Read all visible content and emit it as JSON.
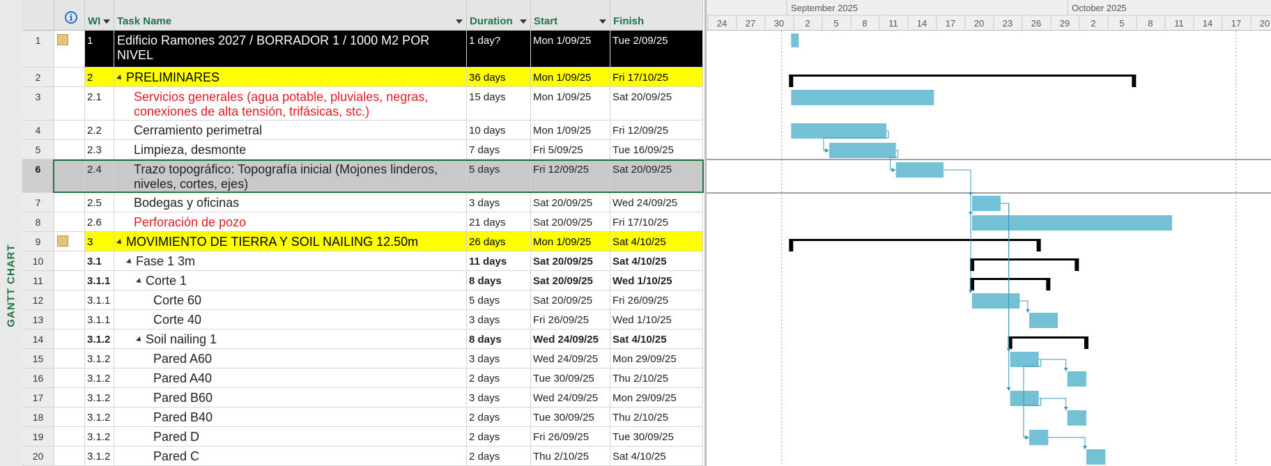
{
  "side_label": "GANTT CHART",
  "columns": {
    "wbs": "WI",
    "name": "Task Name",
    "duration": "Duration",
    "start": "Start",
    "finish": "Finish"
  },
  "colors": {
    "accent": "#217346",
    "bar": "#74c0d4",
    "summary_yellow": "#ffff00",
    "title_black": "#000000",
    "red_text": "#e31b23",
    "link": "#3a9ab4"
  },
  "rows": [
    {
      "id": "1",
      "wbs": "1",
      "name": "Edificio Ramones 2027 / BORRADOR 1 / 1000 M2 POR NIVEL",
      "duration": "1 day?",
      "start": "Mon 1/09/25",
      "finish": "Tue 2/09/25",
      "style": "title",
      "note": true,
      "indent": 0
    },
    {
      "id": "2",
      "wbs": "2",
      "name": "PRELIMINARES",
      "duration": "36 days",
      "start": "Mon 1/09/25",
      "finish": "Fri 17/10/25",
      "style": "yellow",
      "collapse": true,
      "indent": 0
    },
    {
      "id": "3",
      "wbs": "2.1",
      "name": "Servicios generales (agua potable, pluviales, negras, conexiones de alta tensión, trifásicas, stc.)",
      "duration": "15 days",
      "start": "Mon 1/09/25",
      "finish": "Sat 20/09/25",
      "style": "red",
      "indent": 1
    },
    {
      "id": "4",
      "wbs": "2.2",
      "name": "Cerramiento perimetral",
      "duration": "10 days",
      "start": "Mon 1/09/25",
      "finish": "Fri 12/09/25",
      "indent": 1
    },
    {
      "id": "5",
      "wbs": "2.3",
      "name": "Limpieza, desmonte",
      "duration": "7 days",
      "start": "Fri 5/09/25",
      "finish": "Tue 16/09/25",
      "indent": 1
    },
    {
      "id": "6",
      "wbs": "2.4",
      "name": "Trazo topográfico: Topografía inicial (Mojones linderos, niveles, cortes, ejes)",
      "duration": "5 days",
      "start": "Fri 12/09/25",
      "finish": "Sat 20/09/25",
      "style": "sel",
      "indent": 1
    },
    {
      "id": "7",
      "wbs": "2.5",
      "name": "Bodegas y oficinas",
      "duration": "3 days",
      "start": "Sat 20/09/25",
      "finish": "Wed 24/09/25",
      "indent": 1
    },
    {
      "id": "8",
      "wbs": "2.6",
      "name": "Perforación de pozo",
      "duration": "21 days",
      "start": "Sat 20/09/25",
      "finish": "Fri 17/10/25",
      "style": "red",
      "indent": 1
    },
    {
      "id": "9",
      "wbs": "3",
      "name": "MOVIMIENTO DE TIERRA Y SOIL NAILING 12.50m",
      "duration": "26 days",
      "start": "Mon 1/09/25",
      "finish": "Sat 4/10/25",
      "style": "yellow",
      "collapse": true,
      "note": true,
      "indent": 0
    },
    {
      "id": "10",
      "wbs": "3.1",
      "name": "Fase 1 3m",
      "duration": "11 days",
      "start": "Sat 20/09/25",
      "finish": "Sat 4/10/25",
      "style": "summary",
      "collapse": true,
      "indent": 1
    },
    {
      "id": "11",
      "wbs": "3.1.1",
      "name": "Corte 1",
      "duration": "8 days",
      "start": "Sat 20/09/25",
      "finish": "Wed 1/10/25",
      "style": "summary",
      "collapse": true,
      "indent": 2
    },
    {
      "id": "12",
      "wbs": "3.1.1",
      "name": "Corte 60",
      "duration": "5 days",
      "start": "Sat 20/09/25",
      "finish": "Fri 26/09/25",
      "indent": 3
    },
    {
      "id": "13",
      "wbs": "3.1.1",
      "name": "Corte 40",
      "duration": "3 days",
      "start": "Fri 26/09/25",
      "finish": "Wed 1/10/25",
      "indent": 3
    },
    {
      "id": "14",
      "wbs": "3.1.2",
      "name": "Soil nailing 1",
      "duration": "8 days",
      "start": "Wed 24/09/25",
      "finish": "Sat 4/10/25",
      "style": "summary",
      "collapse": true,
      "indent": 2
    },
    {
      "id": "15",
      "wbs": "3.1.2",
      "name": "Pared A60",
      "duration": "3 days",
      "start": "Wed 24/09/25",
      "finish": "Mon 29/09/25",
      "indent": 3
    },
    {
      "id": "16",
      "wbs": "3.1.2",
      "name": "Pared A40",
      "duration": "2 days",
      "start": "Tue 30/09/25",
      "finish": "Thu 2/10/25",
      "indent": 3
    },
    {
      "id": "17",
      "wbs": "3.1.2",
      "name": "Pared B60",
      "duration": "3 days",
      "start": "Wed 24/09/25",
      "finish": "Mon 29/09/25",
      "indent": 3
    },
    {
      "id": "18",
      "wbs": "3.1.2",
      "name": "Pared B40",
      "duration": "2 days",
      "start": "Tue 30/09/25",
      "finish": "Thu 2/10/25",
      "indent": 3
    },
    {
      "id": "19",
      "wbs": "3.1.2",
      "name": "Pared D",
      "duration": "2 days",
      "start": "Fri 26/09/25",
      "finish": "Tue 30/09/25",
      "indent": 3
    },
    {
      "id": "20",
      "wbs": "3.1.2",
      "name": "Pared C",
      "duration": "2 days",
      "start": "Thu 2/10/25",
      "finish": "Sat 4/10/25",
      "indent": 3
    }
  ],
  "timescale": {
    "months": [
      "September 2025",
      "October 2025"
    ],
    "days": [
      "24",
      "27",
      "30",
      "2",
      "5",
      "8",
      "11",
      "14",
      "17",
      "20",
      "23",
      "26",
      "29",
      "2",
      "5",
      "8",
      "11",
      "14",
      "17",
      "20"
    ]
  },
  "gantt": {
    "first_tick_date": "2025-08-24",
    "tick_interval_days": 3,
    "status_line_date": "2025-08-31",
    "status_line_date_2": "2025-10-17",
    "links": [
      [
        "4",
        "5"
      ],
      [
        "5",
        "6"
      ],
      [
        "6",
        "7"
      ],
      [
        "6",
        "8"
      ],
      [
        "6",
        "12"
      ],
      [
        "12",
        "13"
      ],
      [
        "7",
        "15"
      ],
      [
        "7",
        "17"
      ],
      [
        "15",
        "16"
      ],
      [
        "17",
        "18"
      ],
      [
        "15",
        "19"
      ],
      [
        "17",
        "19"
      ],
      [
        "19",
        "20"
      ]
    ]
  }
}
